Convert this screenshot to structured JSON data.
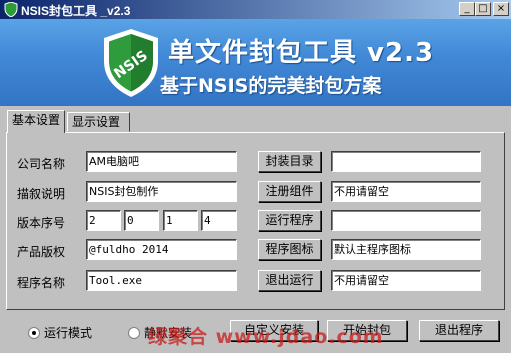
{
  "window": {
    "title": "NSIS封包工具 _v2.3",
    "controls": {
      "minimize": "_",
      "maximize": "□",
      "close": "×"
    }
  },
  "banner": {
    "title": "单文件封包工具 v2.3",
    "subtitle": "基于NSIS的完美封包方案",
    "logo_text": "NSIS"
  },
  "tabs": [
    {
      "label": "基本设置",
      "active": true
    },
    {
      "label": "显示设置",
      "active": false
    }
  ],
  "form": {
    "company": {
      "label": "公司名称",
      "value": "AM电脑吧"
    },
    "description": {
      "label": "描叙说明",
      "value": "NSIS封包制作"
    },
    "version": {
      "label": "版本序号",
      "values": [
        "2",
        "0",
        "1",
        "4"
      ]
    },
    "copyright": {
      "label": "产品版权",
      "value": "@fuldho 2014"
    },
    "program": {
      "label": "程序名称",
      "value": "Tool.exe"
    }
  },
  "right": {
    "pack_dir": {
      "button": "封装目录",
      "value": ""
    },
    "register": {
      "button": "注册组件",
      "value": "不用请留空"
    },
    "run": {
      "button": "运行程序",
      "value": ""
    },
    "icon": {
      "button": "程序图标",
      "value": "默认主程序图标"
    },
    "exit_run": {
      "button": "退出运行",
      "value": "不用请留空"
    }
  },
  "footer": {
    "mode_run": "运行模式",
    "mode_silent": "静默安装",
    "custom_install": "自定义安装",
    "start": "开始封包",
    "exit": "退出程序",
    "selected_mode": "运行模式"
  },
  "watermark": "绿聚合 www.jdao.com"
}
